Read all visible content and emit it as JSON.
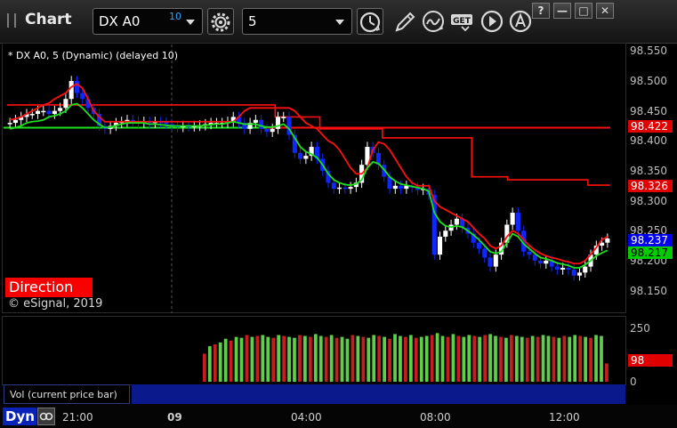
{
  "window": {
    "title": "Chart",
    "controls": [
      "?",
      "—",
      "□",
      "✕"
    ]
  },
  "toolbar": {
    "symbol": "DX A0",
    "symbol_badge": "10",
    "interval": "5",
    "icons": [
      "settings-gear-icon",
      "clock-icon",
      "pencil-draw-icon",
      "study-curve-icon",
      "get-data-icon",
      "play-icon",
      "text-annotation-icon"
    ],
    "get_label": "GET"
  },
  "chart": {
    "study_label": "* DX A0, 5 (Dynamic) (delayed 10)",
    "direction_label": "Direction",
    "copyright": "© eSignal, 2019",
    "price_tags": [
      {
        "value": "98.422",
        "bg": "#e00000",
        "fg": "#ffffff"
      },
      {
        "value": "98.326",
        "bg": "#e00000",
        "fg": "#ffffff"
      },
      {
        "value": "98.237",
        "bg": "#0000ee",
        "fg": "#ffffff"
      },
      {
        "value": "98.217",
        "bg": "#00cc00",
        "fg": "#000000"
      }
    ],
    "volume_tag": {
      "value": "98",
      "bg": "#e00000",
      "fg": "#ffffff"
    },
    "volume_axis": [
      "250",
      "0"
    ],
    "volume_panel_label": "Vol (current price bar)",
    "footer_label": "Dyn",
    "time_labels": [
      "21:00",
      "09",
      "04:00",
      "08:00",
      "12:00"
    ],
    "colors": {
      "bull_candle": "#ffffff",
      "bear_candle": "#1028ff",
      "red_line": "#ff1010",
      "green_line": "#1ee01e",
      "volume_up": "#5fce4a",
      "volume_down": "#c41e1e"
    }
  },
  "chart_data": {
    "type": "line",
    "title": "",
    "y_ticks": [
      "98.550",
      "98.500",
      "98.450",
      "98.400",
      "98.350",
      "98.300",
      "98.250",
      "98.200",
      "98.150"
    ],
    "ylim": [
      98.13,
      98.555
    ],
    "x_ticks": [
      "21:00",
      "09",
      "04:00",
      "08:00",
      "12:00"
    ],
    "x": [
      0,
      5,
      10,
      15,
      20,
      25,
      30,
      35,
      40,
      45,
      50,
      55,
      60,
      65,
      70,
      75,
      80,
      85,
      90,
      95,
      100,
      105,
      110,
      115,
      120,
      125,
      130,
      135,
      140,
      145,
      150,
      155,
      160,
      165,
      170,
      175,
      180,
      185,
      190,
      195,
      200,
      205,
      210,
      215,
      220,
      225,
      230,
      235,
      240,
      245,
      250,
      255,
      260,
      265,
      270,
      275,
      280,
      285,
      290,
      295,
      300,
      305,
      310,
      315,
      320,
      325,
      330,
      335,
      340,
      345,
      350,
      355,
      360,
      365,
      370,
      375,
      380,
      385,
      390,
      395,
      400,
      405,
      410,
      415,
      420,
      425,
      430,
      435,
      440,
      445,
      450,
      455,
      460,
      465,
      470,
      475,
      480,
      485,
      490,
      495,
      500,
      505,
      510,
      515,
      520,
      525,
      530,
      535,
      540,
      545,
      550,
      555,
      560,
      565,
      570,
      575,
      580,
      585,
      590,
      595,
      600,
      605,
      610,
      615,
      620,
      625,
      630,
      635,
      640,
      645,
      650,
      655,
      660,
      665,
      670,
      675
    ],
    "series": [
      {
        "values": [
          98.43,
          98.435,
          98.44,
          98.445,
          98.445,
          98.45,
          98.45,
          98.445,
          98.45,
          98.455,
          98.47,
          98.5,
          98.48,
          98.47,
          98.455,
          98.445,
          98.425,
          98.42,
          98.425,
          98.43,
          98.432,
          98.435,
          98.433,
          98.43,
          98.432,
          98.43,
          98.432,
          98.431,
          98.428,
          98.425,
          98.423,
          98.425,
          98.424,
          98.425,
          98.426,
          98.428,
          98.43,
          98.43,
          98.43,
          98.432,
          98.44,
          98.43,
          98.42,
          98.43,
          98.435,
          98.42,
          98.415,
          98.42,
          98.44,
          98.44,
          98.41,
          98.38,
          98.37,
          98.375,
          98.39,
          98.37,
          98.35,
          98.33,
          98.32,
          98.322,
          98.32,
          98.323,
          98.33,
          98.36,
          98.39,
          98.38,
          98.36,
          98.34,
          98.32,
          98.325,
          98.32,
          98.325,
          98.322,
          98.318,
          98.32,
          98.31,
          98.21,
          98.24,
          98.25,
          98.26,
          98.27,
          98.255,
          98.245,
          98.23,
          98.22,
          98.205,
          98.19,
          98.21,
          98.23,
          98.26,
          98.28,
          98.25,
          98.215,
          98.21,
          98.2,
          98.195,
          98.2,
          98.19,
          98.185,
          98.188,
          98.185,
          98.175,
          98.18,
          98.19,
          98.21,
          98.225,
          98.23,
          98.237
        ]
      },
      {
        "values": [
          98.435,
          98.437,
          98.44,
          98.445,
          98.45,
          98.455,
          98.46,
          98.463,
          98.47,
          98.475,
          98.48,
          98.49,
          98.495,
          98.488,
          98.47,
          98.45,
          98.44,
          98.432,
          98.432,
          98.432,
          98.432,
          98.432,
          98.432,
          98.432,
          98.432,
          98.432,
          98.432,
          98.432,
          98.432,
          98.432,
          98.432,
          98.432,
          98.432,
          98.432,
          98.432,
          98.432,
          98.432,
          98.432,
          98.432,
          98.432,
          98.432,
          98.44,
          98.45,
          98.455,
          98.455,
          98.455,
          98.455,
          98.455,
          98.455,
          98.455,
          98.455,
          98.45,
          98.44,
          98.43,
          98.425,
          98.42,
          98.41,
          98.4,
          98.395,
          98.385,
          98.37,
          98.355,
          98.345,
          98.345,
          98.355,
          98.385,
          98.398,
          98.395,
          98.385,
          98.37,
          98.355,
          98.34,
          98.33,
          98.325,
          98.325,
          98.325,
          98.3,
          98.29,
          98.285,
          98.28,
          98.275,
          98.27,
          98.265,
          98.255,
          98.245,
          98.237,
          98.225,
          98.22,
          98.225,
          98.24,
          98.25,
          98.245,
          98.235,
          98.225,
          98.218,
          98.212,
          98.208,
          98.205,
          98.203,
          98.2,
          98.198,
          98.195,
          98.195,
          98.2,
          98.21,
          98.222,
          98.235,
          98.24
        ]
      },
      {
        "values": [
          98.42,
          98.422,
          98.425,
          98.43,
          98.432,
          98.433,
          98.435,
          98.44,
          98.442,
          98.445,
          98.45,
          98.46,
          98.462,
          98.455,
          98.445,
          98.435,
          98.428,
          98.422,
          98.423,
          98.426,
          98.428,
          98.43,
          98.43,
          98.43,
          98.43,
          98.428,
          98.428,
          98.427,
          98.426,
          98.425,
          98.425,
          98.425,
          98.425,
          98.425,
          98.425,
          98.426,
          98.427,
          98.428,
          98.428,
          98.43,
          98.432,
          98.43,
          98.428,
          98.428,
          98.428,
          98.425,
          98.423,
          98.423,
          98.425,
          98.428,
          98.42,
          98.405,
          98.39,
          98.382,
          98.378,
          98.372,
          98.36,
          98.345,
          98.335,
          98.33,
          98.327,
          98.326,
          98.328,
          98.335,
          98.355,
          98.365,
          98.362,
          98.352,
          98.34,
          98.333,
          98.328,
          98.326,
          98.324,
          98.322,
          98.32,
          98.316,
          98.28,
          98.265,
          98.258,
          98.256,
          98.258,
          98.256,
          98.25,
          98.243,
          98.235,
          98.225,
          98.215,
          98.212,
          98.215,
          98.23,
          98.245,
          98.24,
          98.228,
          98.22,
          98.212,
          98.205,
          98.203,
          98.2,
          98.196,
          98.194,
          98.192,
          98.188,
          98.188,
          98.193,
          98.2,
          98.208,
          98.213,
          98.217
        ]
      }
    ],
    "horizontal_lines": [
      {
        "value": 98.422,
        "color": "#ff1010"
      },
      {
        "value": 98.422,
        "color": "#1ee01e"
      }
    ],
    "red_step_line": {
      "x": [
        0,
        100,
        270,
        300,
        350,
        420,
        520,
        560,
        650,
        675
      ],
      "values": [
        98.46,
        98.46,
        98.46,
        98.44,
        98.42,
        98.405,
        98.34,
        98.335,
        98.326,
        98.326
      ]
    },
    "volume": {
      "ylim": [
        0,
        300
      ],
      "values": [
        150,
        190,
        200,
        210,
        230,
        220,
        240,
        235,
        250,
        240,
        245,
        250,
        240,
        235,
        250,
        245,
        240,
        235,
        250,
        245,
        240,
        255,
        245,
        240,
        250,
        235,
        240,
        230,
        250,
        245,
        240,
        235,
        250,
        245,
        240,
        230,
        255,
        245,
        240,
        250,
        235,
        240,
        245,
        250,
        260,
        245,
        240,
        255,
        245,
        240,
        250,
        245,
        240,
        250,
        255,
        245,
        240,
        235,
        250,
        245,
        240,
        235,
        245,
        240,
        250,
        245,
        240,
        235,
        245,
        240,
        250,
        245,
        240,
        235,
        250,
        245,
        98
      ],
      "up": [
        0,
        1,
        0,
        1,
        1,
        0,
        1,
        1,
        0,
        1,
        0,
        1,
        1,
        0,
        1,
        0,
        1,
        1,
        0,
        1,
        0,
        1,
        1,
        0,
        1,
        0,
        1,
        1,
        0,
        1,
        0,
        1,
        1,
        0,
        1,
        0,
        1,
        1,
        0,
        1,
        0,
        1,
        1,
        0,
        1,
        1,
        0,
        1,
        0,
        1,
        1,
        0,
        1,
        0,
        1,
        1,
        0,
        1,
        0,
        1,
        1,
        0,
        1,
        0,
        1,
        1,
        0,
        1,
        0,
        1,
        1,
        0,
        1,
        0,
        1,
        1,
        0
      ]
    }
  }
}
